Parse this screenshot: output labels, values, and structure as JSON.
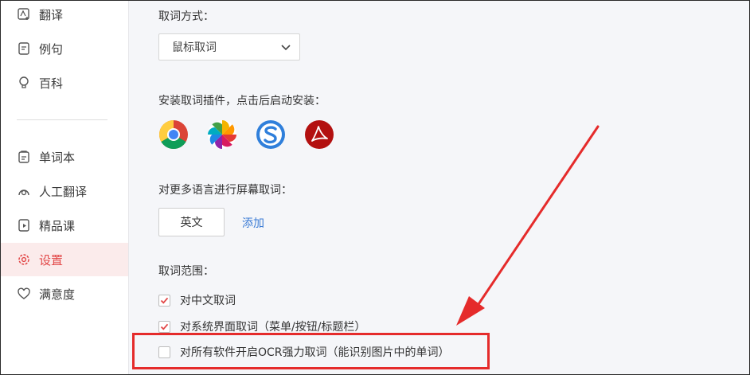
{
  "sidebar": {
    "items": [
      {
        "label": "翻译",
        "icon": "translate-icon"
      },
      {
        "label": "例句",
        "icon": "example-sentence-icon"
      },
      {
        "label": "百科",
        "icon": "bulb-icon"
      },
      {
        "label": "单词本",
        "icon": "wordbook-icon"
      },
      {
        "label": "人工翻译",
        "icon": "human-translate-icon"
      },
      {
        "label": "精品课",
        "icon": "course-icon"
      },
      {
        "label": "设置",
        "icon": "gear-icon",
        "active": true
      },
      {
        "label": "满意度",
        "icon": "heart-icon"
      }
    ]
  },
  "settings": {
    "capture_mode_label": "取词方式：",
    "capture_mode_value": "鼠标取词",
    "plugins_label": "安装取词插件，点击后启动安装：",
    "plugins": [
      "chrome-icon",
      "photos-pinwheel-icon",
      "sogou-s-icon",
      "acrobat-icon"
    ],
    "more_languages_label": "对更多语言进行屏幕取词：",
    "language": "英文",
    "add_label": "添加",
    "scope_label": "取词范围：",
    "scope_options": [
      {
        "label": "对中文取词",
        "checked": true
      },
      {
        "label": "对系统界面取词（菜单/按钮/标题栏）",
        "checked": true
      },
      {
        "label": "对所有软件开启OCR强力取词（能识别图片中的单词）",
        "checked": false
      }
    ]
  },
  "colors": {
    "accent": "#e24646",
    "link": "#3a7bd5",
    "annotation": "#e52b2b"
  }
}
